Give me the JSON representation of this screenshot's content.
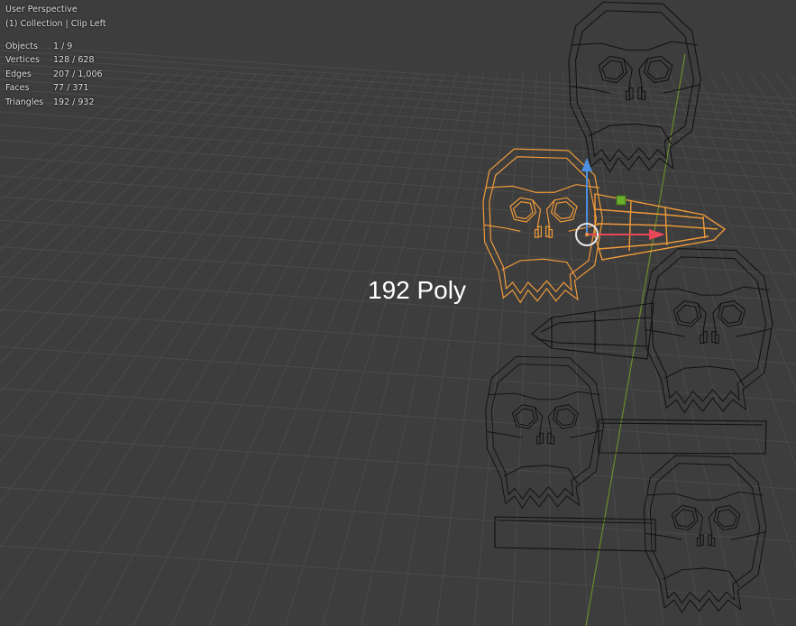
{
  "viewport": {
    "view_name": "User Perspective",
    "collection_line": "(1) Collection | Clip Left",
    "stats": [
      {
        "label": "Objects",
        "value": "1 / 9"
      },
      {
        "label": "Vertices",
        "value": "128 / 628"
      },
      {
        "label": "Edges",
        "value": "207 / 1,006"
      },
      {
        "label": "Faces",
        "value": "77 / 371"
      },
      {
        "label": "Triangles",
        "value": "192 / 932"
      }
    ]
  },
  "annotation": {
    "text": "192 Poly"
  },
  "colors": {
    "background": "#3d3d3d",
    "grid": "#4a4a4a",
    "selection": "#ee9a3a",
    "wire": "#111111",
    "axis_x": "#e8485a",
    "axis_z": "#4c8fe0",
    "axis_y_line": "#6a8c2a",
    "gizmo_handle": "#6ab02e"
  },
  "icons": {
    "transform_pivot": "pivot-circle-icon",
    "axis_x": "arrow-right-icon",
    "axis_z": "arrow-up-icon",
    "plane_handle": "square-handle-icon"
  }
}
